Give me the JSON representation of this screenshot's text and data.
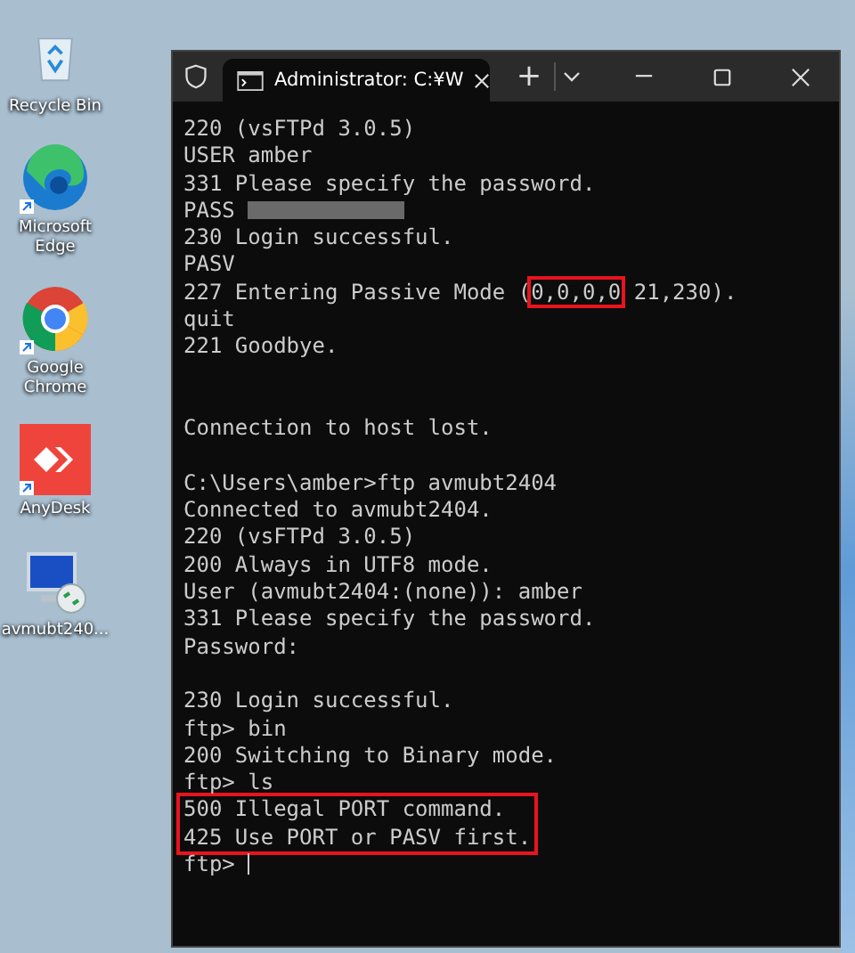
{
  "desktop_icons": [
    {
      "kind": "recycle",
      "label": "Recycle Bin",
      "shortcut": false
    },
    {
      "kind": "edge",
      "label": "Microsoft Edge",
      "shortcut": true
    },
    {
      "kind": "chrome",
      "label": "Google Chrome",
      "shortcut": true
    },
    {
      "kind": "anydesk",
      "label": "AnyDesk",
      "shortcut": true
    },
    {
      "kind": "remote",
      "label": "avmubt240...",
      "shortcut": false
    }
  ],
  "window": {
    "tab_title": "Administrator: C:¥W",
    "new_tab": "+"
  },
  "terminal_lines": [
    {
      "kind": "text",
      "text": "220 (vsFTPd 3.0.5)"
    },
    {
      "kind": "text",
      "text": "USER amber"
    },
    {
      "kind": "text",
      "text": "331 Please specify the password."
    },
    {
      "kind": "masked",
      "text": "PASS"
    },
    {
      "kind": "text",
      "text": "230 Login successful."
    },
    {
      "kind": "text",
      "text": "PASV"
    },
    {
      "kind": "boxed",
      "before": "227 Entering Passive Mode (",
      "boxed": "0,0,0,0",
      "after": " 21,230)."
    },
    {
      "kind": "text",
      "text": "quit"
    },
    {
      "kind": "text",
      "text": "221 Goodbye."
    },
    {
      "kind": "blank"
    },
    {
      "kind": "blank"
    },
    {
      "kind": "text",
      "text": "Connection to host lost."
    },
    {
      "kind": "blank"
    },
    {
      "kind": "text",
      "text": "C:\\Users\\amber>ftp avmubt2404"
    },
    {
      "kind": "text",
      "text": "Connected to avmubt2404."
    },
    {
      "kind": "text",
      "text": "220 (vsFTPd 3.0.5)"
    },
    {
      "kind": "text",
      "text": "200 Always in UTF8 mode."
    },
    {
      "kind": "text",
      "text": "User (avmubt2404:(none)): amber"
    },
    {
      "kind": "text",
      "text": "331 Please specify the password."
    },
    {
      "kind": "text",
      "text": "Password:"
    },
    {
      "kind": "blank"
    },
    {
      "kind": "text",
      "text": "230 Login successful."
    },
    {
      "kind": "text",
      "text": "ftp> bin"
    },
    {
      "kind": "text",
      "text": "200 Switching to Binary mode."
    },
    {
      "kind": "text",
      "text": "ftp> ls"
    },
    {
      "kind": "highlight",
      "lines": [
        "500 Illegal PORT command.",
        "425 Use PORT or PASV first."
      ]
    },
    {
      "kind": "prompt",
      "text": "ftp>"
    }
  ]
}
